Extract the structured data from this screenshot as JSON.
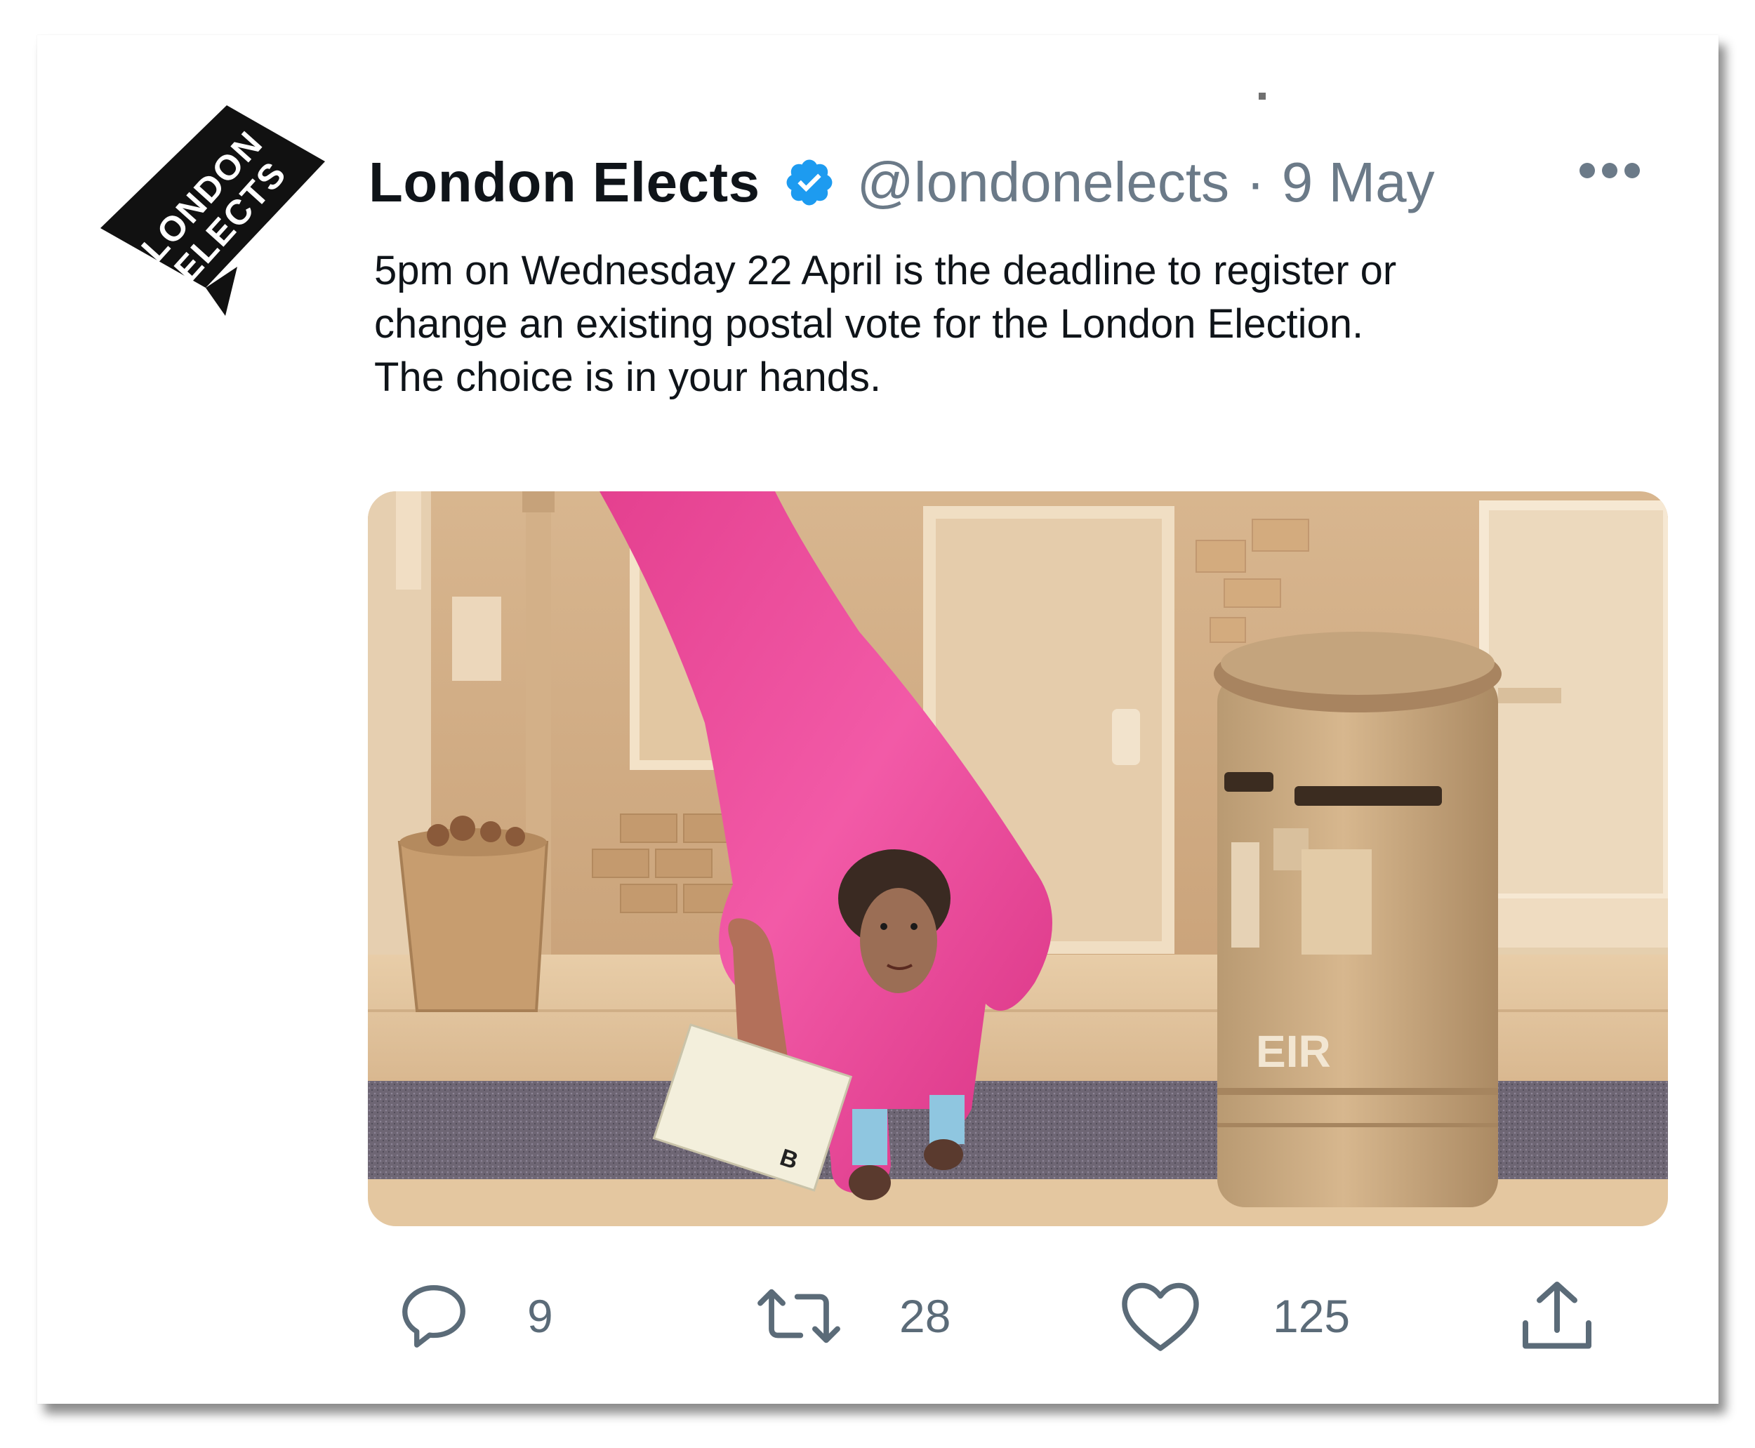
{
  "tweet": {
    "avatar_text": [
      "LONDON",
      "ELECTS"
    ],
    "display_name": "London Elects",
    "verified_icon": "verified-badge-icon",
    "handle": "@londonelects",
    "separator": "·",
    "date": "9 May",
    "text_lines": [
      "5pm on Wednesday 22 April is the deadline to register or",
      "change an existing postal vote for the London Election.",
      "The choice is in your hands."
    ],
    "image_caption_marks": {
      "postbox_cypher": "EIR",
      "envelope_mark": "B"
    }
  },
  "actions": {
    "reply": {
      "icon": "reply-icon",
      "count": "9"
    },
    "retweet": {
      "icon": "retweet-icon",
      "count": "28"
    },
    "like": {
      "icon": "heart-icon",
      "count": "125"
    },
    "share": {
      "icon": "share-icon"
    }
  },
  "colors": {
    "verified_blue": "#1d9bf0",
    "secondary_text": "#6b7a88",
    "primary_text": "#0f1419",
    "action_icon": "#5b6b78"
  }
}
